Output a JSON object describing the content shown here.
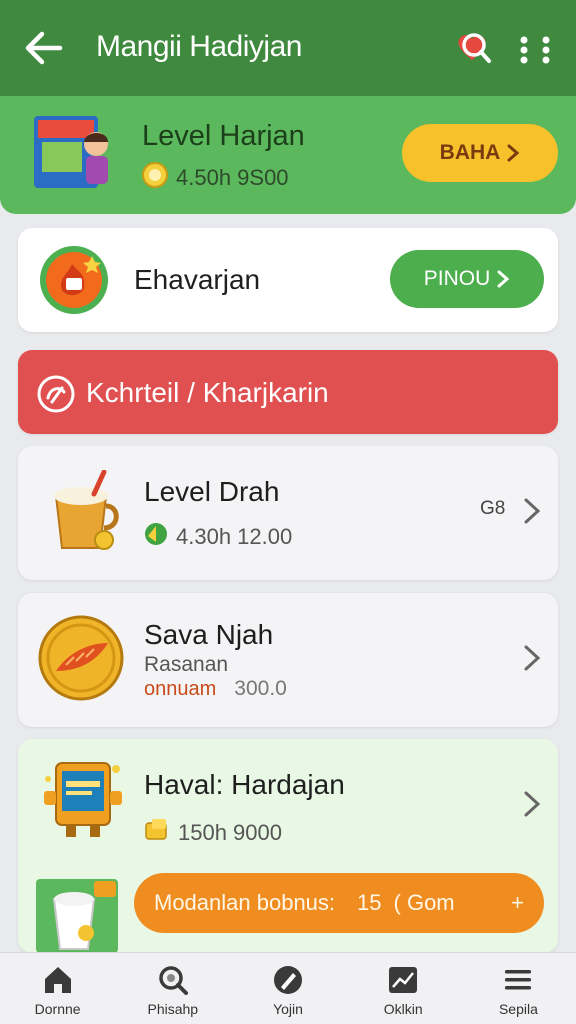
{
  "appbar": {
    "title": "Mangii Hadiyjan",
    "icons": [
      "back-arrow-icon",
      "heart-search-icon",
      "more-vertical-icon"
    ]
  },
  "hero": {
    "title": "Level Harjan",
    "coins": "4.50h 9S00",
    "button": "BAHA",
    "colors": {
      "bg": "#5cb85c",
      "button": "#f7c12c"
    }
  },
  "cards": {
    "c1": {
      "label": "Ehavarjan",
      "button": "PINOU"
    },
    "c2": {
      "label": "Kchrteil / Kharjkarin",
      "color": "#e15050"
    },
    "c3": {
      "label": "Level Drah",
      "coins": "4.30h 12.00",
      "side": "G8"
    },
    "c4": {
      "label": "Sava Njah",
      "sub": "Rasanan",
      "orange": "onnuam",
      "value": "300.0"
    },
    "c5": {
      "label": "Haval: Hardajan",
      "coins": "150h 9000",
      "bonus": "Modanlan bobnus:",
      "bonus_value": "15",
      "bonus_unit": "( Gom",
      "bonus_plus": "+"
    }
  },
  "nav": {
    "items": [
      {
        "label": "Dornne",
        "icon": "home-icon"
      },
      {
        "label": "Phisahp",
        "icon": "search-icon"
      },
      {
        "label": "Yojin",
        "icon": "pen-icon"
      },
      {
        "label": "Oklkin",
        "icon": "stats-icon"
      },
      {
        "label": "Sepila",
        "icon": "menu-icon"
      }
    ]
  }
}
